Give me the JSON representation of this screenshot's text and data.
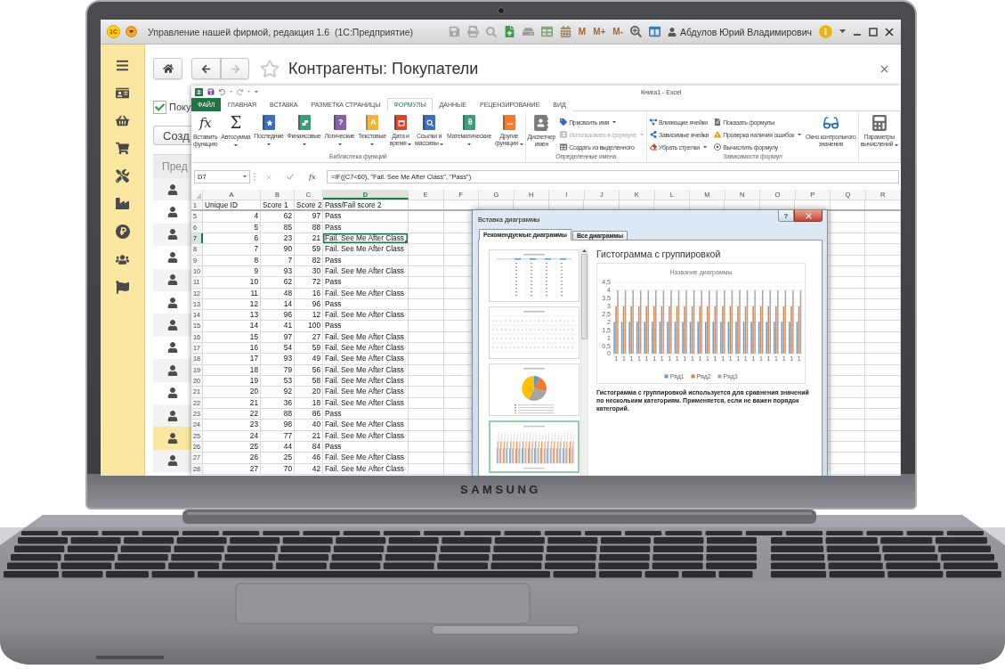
{
  "laptop": {
    "brand": "SAMSUNG"
  },
  "app": {
    "logo": "1С",
    "title": "Управление нашей фирмой, редакция 1.6  (1С:Предприятие)",
    "memory_buttons": [
      "M",
      "M+",
      "M-"
    ],
    "user": "Абдулов Юрий Владимирович",
    "page": {
      "title": "Контрагенты: Покупатели",
      "favorite": false,
      "back_disabled": false,
      "forward_disabled": true,
      "filter": {
        "label": "Поку",
        "checked": true
      },
      "create_button": "Созд",
      "list": {
        "column_1": "Пред",
        "rows": [
          {
            "selected": false
          },
          {
            "selected": false
          },
          {
            "selected": false
          },
          {
            "selected": false
          },
          {
            "selected": false
          },
          {
            "selected": false
          },
          {
            "selected": false
          },
          {
            "selected": false
          },
          {
            "selected": false
          },
          {
            "selected": false
          },
          {
            "selected": false
          },
          {
            "selected": true
          },
          {
            "selected": false
          }
        ]
      }
    }
  },
  "excel": {
    "title": "Книга1 - Excel",
    "tabs": [
      {
        "label": "ФАЙЛ",
        "kind": "file",
        "selected": false
      },
      {
        "label": "ГЛАВНАЯ",
        "kind": "tab",
        "selected": false
      },
      {
        "label": "ВСТАВКА",
        "kind": "tab",
        "selected": false
      },
      {
        "label": "РАЗМЕТКА СТРАНИЦЫ",
        "kind": "tab",
        "selected": false
      },
      {
        "label": "ФОРМУЛЫ",
        "kind": "tab",
        "selected": true
      },
      {
        "label": "ДАННЫЕ",
        "kind": "tab",
        "selected": false
      },
      {
        "label": "РЕЦЕНЗИРОВАНИЕ",
        "kind": "tab",
        "selected": false
      },
      {
        "label": "ВИД",
        "kind": "tab",
        "selected": false
      }
    ],
    "ribbon_groups": [
      {
        "label": "Библиотека функций",
        "items": [
          {
            "kind": "large",
            "label": "Вставить\nфункцию",
            "glyph": "fx",
            "dropdown": false,
            "disabled": false
          },
          {
            "kind": "large",
            "label": "Автосумма",
            "glyph": "Σ",
            "dropdown": true,
            "disabled": false
          },
          {
            "kind": "large",
            "label": "Последние",
            "color": "#3b6fb6",
            "dropdown": true,
            "disabled": false
          },
          {
            "kind": "large",
            "label": "Финансовые",
            "color": "#3d9c7a",
            "dropdown": true,
            "disabled": false
          },
          {
            "kind": "large",
            "label": "Логические",
            "color": "#8064a2",
            "glyph": "?",
            "dropdown": true,
            "disabled": false
          },
          {
            "kind": "large",
            "label": "Текстовые",
            "color": "#f0b440",
            "glyph": "A",
            "dropdown": true,
            "disabled": false
          },
          {
            "kind": "large",
            "label": "Дата и\nвремя",
            "color": "#d9462b",
            "dropdown": true,
            "disabled": false
          },
          {
            "kind": "large",
            "label": "Ссылки и\nмассивы",
            "color": "#3b6fb6",
            "dropdown": true,
            "disabled": false
          },
          {
            "kind": "large",
            "label": "Математические",
            "color": "#3d9c7a",
            "glyph": "θ",
            "dropdown": true,
            "disabled": false
          },
          {
            "kind": "large",
            "label": "Другие\nфункции",
            "color": "#ed7d31",
            "glyph": "...",
            "dropdown": true,
            "disabled": false
          }
        ]
      },
      {
        "label": "Определенные имена",
        "items": [
          {
            "kind": "large",
            "label": "Диспетчер\nимен",
            "dropdown": false,
            "disabled": false
          },
          {
            "kind": "small",
            "label": "Присвоить имя",
            "dropdown": true,
            "disabled": false
          },
          {
            "kind": "small",
            "label": "Использовать в формуле",
            "dropdown": true,
            "disabled": true
          },
          {
            "kind": "small",
            "label": "Создать из выделенного",
            "dropdown": false,
            "disabled": false
          }
        ]
      },
      {
        "label": "Зависимости формул",
        "items": [
          {
            "kind": "small",
            "label": "Влияющие ячейки",
            "dropdown": false,
            "disabled": false
          },
          {
            "kind": "small",
            "label": "Зависимые ячейки",
            "dropdown": false,
            "disabled": false
          },
          {
            "kind": "small",
            "label": "Убрать стрелки",
            "dropdown": true,
            "disabled": false
          },
          {
            "kind": "small",
            "label": "Показать формулы",
            "dropdown": false,
            "disabled": false
          },
          {
            "kind": "small",
            "label": "Проверка наличия ошибок",
            "dropdown": true,
            "disabled": false
          },
          {
            "kind": "small",
            "label": "Вычислить формулу",
            "dropdown": false,
            "disabled": false
          },
          {
            "kind": "large",
            "label": "Окно контрольного\nзначения",
            "dropdown": false,
            "disabled": false
          }
        ]
      },
      {
        "items": [
          {
            "kind": "large",
            "label": "Параметры\nвычислений",
            "dropdown": true,
            "disabled": false
          }
        ]
      }
    ],
    "formula_bar": {
      "name_box": "D7",
      "function_button": "fx",
      "formula": "=IF((C7<60), \"Fail. See Me After Class\", \"Pass\")"
    },
    "sheet": {
      "columns": [
        {
          "label": "A",
          "selected": false
        },
        {
          "label": "B",
          "selected": false
        },
        {
          "label": "C",
          "selected": false
        },
        {
          "label": "D",
          "selected": true
        },
        {
          "label": "E",
          "selected": false
        },
        {
          "label": "F",
          "selected": false
        },
        {
          "label": "G",
          "selected": false
        },
        {
          "label": "H",
          "selected": false
        },
        {
          "label": "I",
          "selected": false
        },
        {
          "label": "J",
          "selected": false
        },
        {
          "label": "K",
          "selected": false
        },
        {
          "label": "L",
          "selected": false
        },
        {
          "label": "M",
          "selected": false
        },
        {
          "label": "N",
          "selected": false
        },
        {
          "label": "O",
          "selected": false
        },
        {
          "label": "P",
          "selected": false
        },
        {
          "label": "Q",
          "selected": false
        },
        {
          "label": "R",
          "selected": false
        }
      ],
      "rows": [
        {
          "number": "1",
          "kind": "header",
          "selected": false,
          "cells": [
            "Unique ID",
            "Score 1",
            "Score 2",
            "Pass/Fail score 2"
          ]
        },
        {
          "number": "5",
          "kind": "data",
          "selected": false,
          "cells": [
            "4",
            "62",
            "97",
            "Pass"
          ]
        },
        {
          "number": "6",
          "kind": "data",
          "selected": false,
          "cells": [
            "5",
            "85",
            "88",
            "Pass"
          ]
        },
        {
          "number": "7",
          "kind": "data",
          "selected": true,
          "cells": [
            "6",
            "23",
            "21",
            "Fail. See Me After Class"
          ]
        },
        {
          "number": "8",
          "kind": "data",
          "selected": false,
          "cells": [
            "7",
            "90",
            "59",
            "Fail. See Me After Class"
          ]
        },
        {
          "number": "9",
          "kind": "data",
          "selected": false,
          "cells": [
            "8",
            "7",
            "82",
            "Pass"
          ]
        },
        {
          "number": "10",
          "kind": "data",
          "selected": false,
          "cells": [
            "9",
            "93",
            "30",
            "Fail. See Me After Class"
          ]
        },
        {
          "number": "11",
          "kind": "data",
          "selected": false,
          "cells": [
            "10",
            "62",
            "72",
            "Pass"
          ]
        },
        {
          "number": "12",
          "kind": "data",
          "selected": false,
          "cells": [
            "11",
            "48",
            "16",
            "Fail. See Me After Class"
          ]
        },
        {
          "number": "13",
          "kind": "data",
          "selected": false,
          "cells": [
            "12",
            "14",
            "96",
            "Pass"
          ]
        },
        {
          "number": "14",
          "kind": "data",
          "selected": false,
          "cells": [
            "13",
            "96",
            "12",
            "Fail. See Me After Class"
          ]
        },
        {
          "number": "15",
          "kind": "data",
          "selected": false,
          "cells": [
            "14",
            "41",
            "100",
            "Pass"
          ]
        },
        {
          "number": "16",
          "kind": "data",
          "selected": false,
          "cells": [
            "15",
            "97",
            "27",
            "Fail. See Me After Class"
          ]
        },
        {
          "number": "17",
          "kind": "data",
          "selected": false,
          "cells": [
            "16",
            "54",
            "59",
            "Fail. See Me After Class"
          ]
        },
        {
          "number": "18",
          "kind": "data",
          "selected": false,
          "cells": [
            "17",
            "93",
            "49",
            "Fail. See Me After Class"
          ]
        },
        {
          "number": "19",
          "kind": "data",
          "selected": false,
          "cells": [
            "18",
            "79",
            "56",
            "Fail. See Me After Class"
          ]
        },
        {
          "number": "20",
          "kind": "data",
          "selected": false,
          "cells": [
            "19",
            "53",
            "58",
            "Fail. See Me After Class"
          ]
        },
        {
          "number": "21",
          "kind": "data",
          "selected": false,
          "cells": [
            "20",
            "92",
            "20",
            "Fail. See Me After Class"
          ]
        },
        {
          "number": "22",
          "kind": "data",
          "selected": false,
          "cells": [
            "21",
            "36",
            "18",
            "Fail. See Me After Class"
          ]
        },
        {
          "number": "23",
          "kind": "data",
          "selected": false,
          "cells": [
            "22",
            "88",
            "86",
            "Pass"
          ]
        },
        {
          "number": "24",
          "kind": "data",
          "selected": false,
          "cells": [
            "23",
            "98",
            "40",
            "Fail. See Me After Class"
          ]
        },
        {
          "number": "25",
          "kind": "data",
          "selected": false,
          "cells": [
            "24",
            "77",
            "21",
            "Fail. See Me After Class"
          ]
        },
        {
          "number": "26",
          "kind": "data",
          "selected": false,
          "cells": [
            "25",
            "44",
            "84",
            "Pass"
          ]
        },
        {
          "number": "27",
          "kind": "data",
          "selected": false,
          "cells": [
            "26",
            "25",
            "46",
            "Fail. See Me After Class"
          ]
        },
        {
          "number": "28",
          "kind": "data",
          "selected": false,
          "cells": [
            "27",
            "70",
            "42",
            "Fail. See Me After Class"
          ]
        }
      ]
    },
    "chart_dialog": {
      "title": "Вставка диаграммы",
      "help": "?",
      "tabs": [
        {
          "label": "Рекомендуемые диаграммы",
          "selected": true
        },
        {
          "label": "Все диаграммы",
          "selected": false
        }
      ],
      "thumbnails": [
        {
          "kind": "table",
          "selected": false
        },
        {
          "kind": "line",
          "selected": false
        },
        {
          "kind": "pie",
          "selected": false
        },
        {
          "kind": "column",
          "selected": true
        }
      ],
      "heading": "Гистограмма с группировкой",
      "preview": {
        "chart_data": {
          "type": "bar",
          "orientation": "vertical",
          "title": "Название диаграммы",
          "grid": true,
          "legend": "bottom",
          "categories": [
            "1",
            "1",
            "1",
            "1",
            "1",
            "1",
            "1",
            "1",
            "1",
            "1",
            "1",
            "1",
            "1",
            "1",
            "1",
            "1",
            "1",
            "1",
            "1",
            "1",
            "1",
            "1",
            "1",
            "1",
            "1"
          ],
          "series": [
            {
              "name": "Ряд1",
              "color": "#5b9bd5",
              "values": [
                2,
                2,
                2,
                2,
                2,
                2,
                2,
                2,
                2,
                2,
                2,
                2,
                2,
                2,
                2,
                2,
                2,
                2,
                2,
                2,
                2,
                2,
                2,
                2,
                2
              ]
            },
            {
              "name": "Ряд2",
              "color": "#ed7d31",
              "values": [
                3,
                3,
                3,
                3,
                3,
                3,
                3,
                3,
                3,
                3,
                3,
                3,
                3,
                3,
                3,
                3,
                3,
                3,
                3,
                3,
                3,
                3,
                3,
                3,
                3
              ]
            },
            {
              "name": "Ряд3",
              "color": "#a5a5a5",
              "values": [
                4,
                4,
                4,
                4,
                4,
                4,
                4,
                4,
                4,
                4,
                4,
                4,
                4,
                4,
                4,
                4,
                4,
                4,
                4,
                4,
                4,
                4,
                4,
                4,
                4
              ]
            }
          ],
          "ylim": [
            0,
            4.5
          ],
          "yticks": [
            {
              "value": 0,
              "label": "0"
            },
            {
              "value": 0.5,
              "label": "0,5"
            },
            {
              "value": 1,
              "label": "1"
            },
            {
              "value": 1.5,
              "label": "1,5"
            },
            {
              "value": 2,
              "label": "2"
            },
            {
              "value": 2.5,
              "label": "2,5"
            },
            {
              "value": 3,
              "label": "3"
            },
            {
              "value": 3.5,
              "label": "3,5"
            },
            {
              "value": 4,
              "label": "4"
            },
            {
              "value": 4.5,
              "label": "4,5"
            }
          ]
        }
      },
      "description": "Гистограмма с группировкой используется для сравнения значений по нескольким категориям. Применяется, если не важен порядок категорий."
    }
  }
}
